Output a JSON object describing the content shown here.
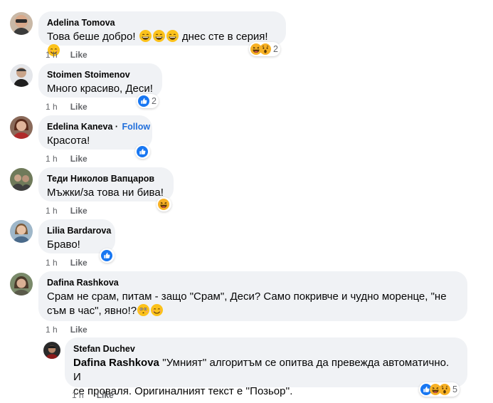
{
  "comments": [
    {
      "author": "Adelina Tomova",
      "text": "Това беше добро!",
      "text_after": "днес сте в серия!",
      "time": "1 h",
      "like_label": "Like",
      "reactions": [
        "haha-icon",
        "wow-icon"
      ],
      "reaction_count": "2"
    },
    {
      "author": "Stoimen Stoimenov",
      "text": "Много красиво, Деси!",
      "time": "1 h",
      "like_label": "Like",
      "reactions": [
        "like-icon"
      ],
      "reaction_count": "2"
    },
    {
      "author": "Edelina Kaneva",
      "follow_label": "Follow",
      "text": "Красота!",
      "time": "1 h",
      "like_label": "Like",
      "reactions": [
        "like-icon"
      ]
    },
    {
      "author": "Теди Николов Вапцаров",
      "text": "Мъжки/за това ни бива!",
      "time": "1 h",
      "like_label": "Like",
      "reactions": [
        "haha-icon"
      ]
    },
    {
      "author": "Lilia Bardarova",
      "text": "Браво!",
      "time": "1 h",
      "like_label": "Like",
      "reactions": [
        "like-icon"
      ]
    },
    {
      "author": "Dafina Rashkova",
      "text_line1": "Срам не срам, питам - защо \"Срам\", Деси? Само покривче и чудно моренце, \"не",
      "text_line2": "съм в час\", явно!?",
      "time": "1 h",
      "like_label": "Like"
    }
  ],
  "reply": {
    "author": "Stefan Duchev",
    "mention": "Dafina Rashkova",
    "text_line1": "''Умният'' алгоритъм се опитва да превежда автоматично. И",
    "text_line2": "се проваля. Оригиналният текст е ''Позьор''.",
    "time": "1 h",
    "like_label": "Like",
    "reactions": [
      "like-icon",
      "haha-icon",
      "wow-icon"
    ],
    "reaction_count": "5"
  },
  "colors": {
    "bubble": "#f0f2f5",
    "meta_text": "#65676b",
    "follow_link": "#216fdb",
    "like_blue": "#1877f2",
    "emoji_yellow": "#f7b125"
  }
}
